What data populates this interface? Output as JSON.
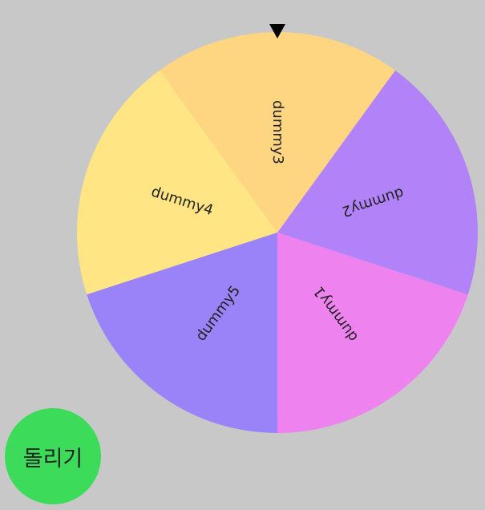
{
  "wheel": {
    "segments": [
      {
        "label": "dummy1",
        "color": "#ee82ee"
      },
      {
        "label": "dummy2",
        "color": "#b283f8"
      },
      {
        "label": "dummy3",
        "color": "#fed682"
      },
      {
        "label": "dummy4",
        "color": "#ffe583"
      },
      {
        "label": "dummy5",
        "color": "#9a83f8"
      }
    ],
    "pointer_icon": "triangle-down-icon"
  },
  "spin_button": {
    "label": "돌리기",
    "color": "#3cdc5a"
  },
  "background_color": "#c8c8c8"
}
